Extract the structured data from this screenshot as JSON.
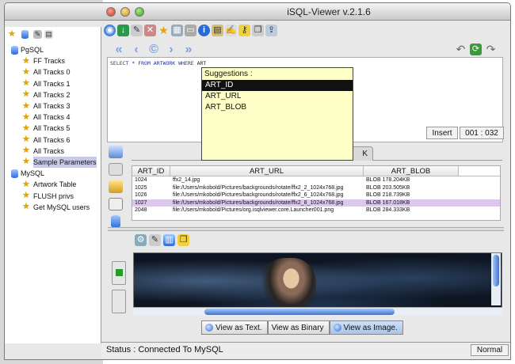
{
  "window": {
    "title": "iSQL-Viewer v.2.1.6"
  },
  "tree": {
    "groups": [
      {
        "name": "PgSQL",
        "items": [
          "FF Tracks",
          "All Tracks 0",
          "All Tracks 1",
          "All Tracks 2",
          "All Tracks 3",
          "All Tracks 4",
          "All Tracks 5",
          "All Tracks 6",
          "All Tracks",
          "Sample Parameters"
        ]
      },
      {
        "name": "MySQL",
        "items": [
          "Artwork Table",
          "FLUSH privs",
          "Get MySQL users"
        ]
      }
    ]
  },
  "editor": {
    "sql_keywords": "SELECT * FROM ARTWORK WHERE",
    "sql_rest": "ART"
  },
  "editor_status": {
    "insert_mode": "Insert",
    "position": "001 : 032"
  },
  "suggestions": {
    "title": "Suggestions :",
    "items": [
      "ART_ID",
      "ART_URL",
      "ART_BLOB"
    ],
    "selected": "ART_ID"
  },
  "results": {
    "tab_label": "K",
    "columns": [
      "ART_ID",
      "ART_URL",
      "ART_BLOB"
    ],
    "rows": [
      [
        "1024",
        "ffx2_14.jpg",
        "BLOB 178.204KB"
      ],
      [
        "1025",
        "file:/Users/mkobold/Pictures/backgrounds/rotate/ffx2_2_1024x768.jpg",
        "BLOB 203.505KB"
      ],
      [
        "1026",
        "file:/Users/mkobold/Pictures/backgrounds/rotate/ffx2_6_1024x768.jpg",
        "BLOB 218.739KB"
      ],
      [
        "1027",
        "file:/Users/mkobold/Pictures/backgrounds/rotate/ffx2_8_1024x768.jpg",
        "BLOB 167.018KB"
      ],
      [
        "2048",
        "file:/Users/mkobold/Pictures/org.isqlviewer.core.Launcher001.png",
        "BLOB 284.333KB"
      ]
    ],
    "selected_row": 3
  },
  "view_tabs": [
    {
      "label": "View as Text.",
      "active": false
    },
    {
      "label": "View as Binary",
      "active": false
    },
    {
      "label": "View as Image.",
      "active": true
    }
  ],
  "status": {
    "text": "Status : Connected To MySQL",
    "mode": "Normal"
  },
  "icons": {
    "main_toolbar": [
      "globe-icon",
      "connect-icon",
      "edit-icon",
      "wrench-icon",
      "star-icon",
      "database-icon",
      "print-icon",
      "info-icon",
      "note-icon",
      "pen-icon",
      "key-icon",
      "copy-icon",
      "export-icon"
    ],
    "nav": [
      "first-icon",
      "back-icon",
      "refresh-icon",
      "forward-icon",
      "last-icon"
    ]
  },
  "colors": {
    "suggest_bg": "#ffffc8",
    "selected_row": "#dcc8ee",
    "star": "#e3a800"
  }
}
